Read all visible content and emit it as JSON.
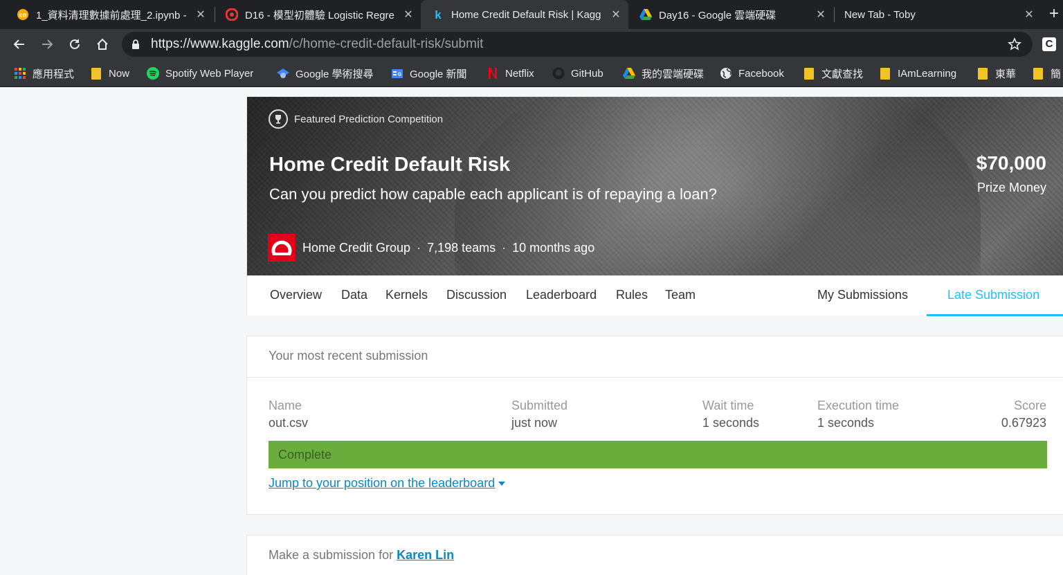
{
  "browser": {
    "tabs": [
      {
        "title": "1_資料清理數據前處理_2.ipynb -",
        "icon": "colab-icon"
      },
      {
        "title": "D16 - 模型初體驗 Logistic Regre",
        "icon": "cupoy-icon"
      },
      {
        "title": "Home Credit Default Risk | Kagg",
        "icon": "kaggle-icon",
        "active": true
      },
      {
        "title": "Day16 - Google 雲端硬碟",
        "icon": "drive-icon"
      },
      {
        "title": "New Tab - Toby",
        "icon": "none"
      }
    ],
    "url_scheme_host": "https://www.kaggle.com",
    "url_path": "/c/home-credit-default-risk/submit",
    "bookmarks": [
      {
        "label": "應用程式",
        "icon": "apps-grid-icon"
      },
      {
        "label": "Now",
        "icon": "folder-icon"
      },
      {
        "label": "Spotify Web Player",
        "icon": "spotify-icon"
      },
      {
        "label": "Google 學術搜尋",
        "icon": "scholar-icon"
      },
      {
        "label": "Google 新聞",
        "icon": "news-icon"
      },
      {
        "label": "Netflix",
        "icon": "netflix-icon"
      },
      {
        "label": "GitHub",
        "icon": "github-icon"
      },
      {
        "label": "我的雲端硬碟",
        "icon": "drive-icon"
      },
      {
        "label": "Facebook",
        "icon": "globe-icon"
      },
      {
        "label": "文獻查找",
        "icon": "folder-icon"
      },
      {
        "label": "IAmLearning",
        "icon": "folder-icon"
      },
      {
        "label": "東華",
        "icon": "folder-icon"
      },
      {
        "label": "簡",
        "icon": "folder-icon"
      }
    ]
  },
  "competition": {
    "featured_label": "Featured Prediction Competition",
    "title": "Home Credit Default Risk",
    "subtitle": "Can you predict how capable each applicant is of repaying a loan?",
    "prize": "$70,000",
    "prize_label": "Prize Money",
    "host": "Home Credit Group",
    "teams": "7,198 teams",
    "age": "10 months ago"
  },
  "nav": {
    "items": [
      "Overview",
      "Data",
      "Kernels",
      "Discussion",
      "Leaderboard",
      "Rules",
      "Team"
    ],
    "my_submissions": "My Submissions",
    "late_submission": "Late Submission"
  },
  "recent": {
    "heading": "Your most recent submission",
    "labels": {
      "name": "Name",
      "submitted": "Submitted",
      "wait": "Wait time",
      "exec": "Execution time",
      "score": "Score"
    },
    "values": {
      "name": "out.csv",
      "submitted": "just now",
      "wait": "1 seconds",
      "exec": "1 seconds",
      "score": "0.67923"
    },
    "status": "Complete",
    "status_color": "#6aad3c",
    "jump_link": "Jump to your position on the leaderboard"
  },
  "make": {
    "prefix": "Make a submission for",
    "user": "Karen Lin"
  },
  "colors": {
    "accent": "#20beff",
    "link": "#0b87c4",
    "host_logo": "#e3001b"
  }
}
